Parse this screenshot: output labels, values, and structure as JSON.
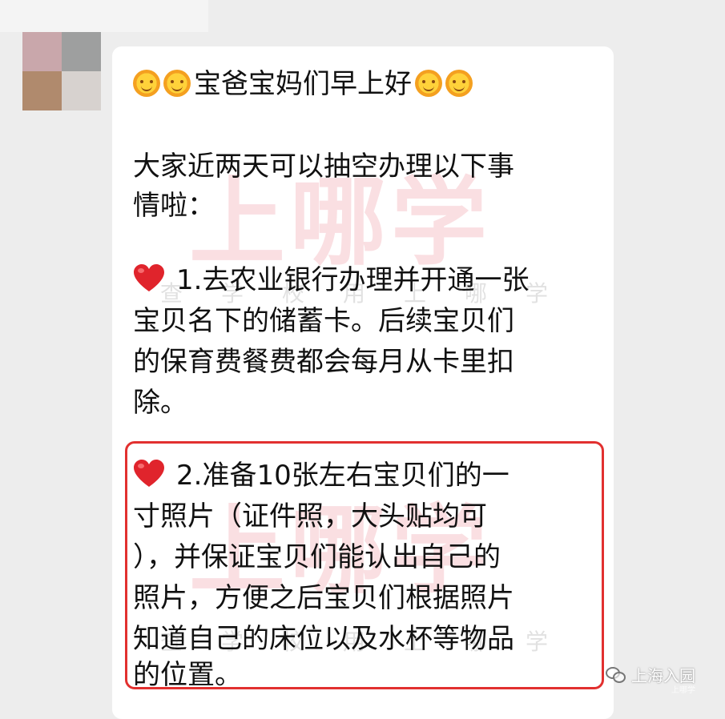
{
  "chat": {
    "greeting": "宝爸宝妈们早上好",
    "intro_line1": "大家近两天可以抽空办理以下事",
    "intro_line2": "情啦：",
    "item1_lines": [
      "1.去农业银行办理并开通一张",
      "宝贝名下的储蓄卡。后续宝贝们",
      "的保育费餐费都会每月从卡里扣",
      "除。"
    ],
    "item2_lines": [
      "2.准备10张左右宝贝们的一",
      "寸照片（证件照，大头贴均可",
      "），并保证宝贝们能认出自己的",
      "照片，方便之后宝贝们根据照片",
      "知道自己的床位以及水杯等物品",
      "的位置。"
    ]
  },
  "watermarks": {
    "big": "上哪学",
    "small": "查学校用上哪学"
  },
  "footer": {
    "account": "上海入园",
    "sub": "上哪学"
  },
  "icons": {
    "sun": "sun-face-emoji-icon",
    "heart": "red-heart-emoji-icon",
    "wechat": "wechat-icon"
  },
  "colors": {
    "highlight_border": "#e2302f",
    "heart": "#e0242c"
  }
}
